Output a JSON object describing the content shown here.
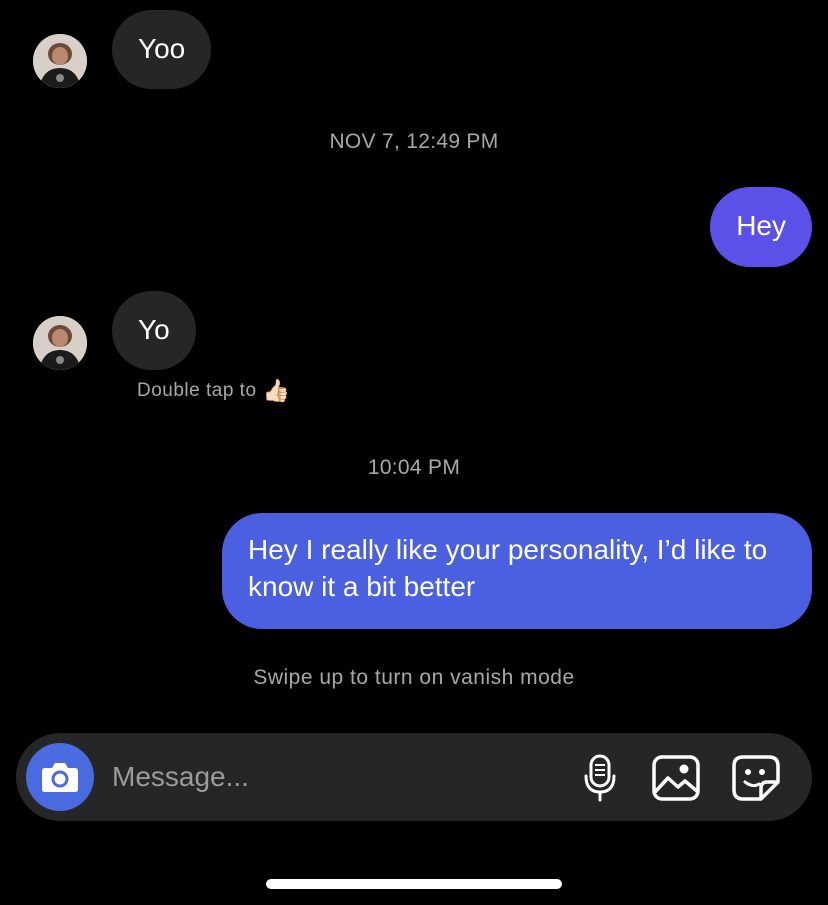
{
  "thread": {
    "messages": [
      {
        "sender": "them",
        "text": "Yoo"
      },
      {
        "sender": "me",
        "text": "Hey"
      },
      {
        "sender": "them",
        "text": "Yo"
      },
      {
        "sender": "me",
        "text": "Hey I really like your personality, I’d like to know it a bit better"
      }
    ],
    "timestamps": [
      "NOV 7, 12:49 PM",
      "10:04 PM"
    ],
    "double_tap_hint": "Double tap to",
    "double_tap_emoji": "👍🏻",
    "vanish_hint": "Swipe up to turn on vanish mode"
  },
  "composer": {
    "placeholder": "Message...",
    "camera_icon": "camera-icon",
    "mic_icon": "microphone-icon",
    "gallery_icon": "image-gallery-icon",
    "sticker_icon": "sticker-icon"
  },
  "colors": {
    "background": "#000000",
    "incoming_bubble": "#262626",
    "outgoing_bubble": "#5b51e8",
    "outgoing_bubble_latest": "#4a60e0",
    "camera_button": "#4a6be0",
    "secondary_text": "#a8a8a8"
  }
}
